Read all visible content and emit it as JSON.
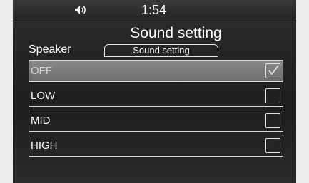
{
  "status_bar": {
    "clock": "1:54",
    "volume_icon": "speaker-volume-icon"
  },
  "header": {
    "title": "Sound setting",
    "section_label": "Speaker",
    "tab_label": "Sound setting"
  },
  "options": [
    {
      "label": "OFF",
      "checked": true
    },
    {
      "label": "LOW",
      "checked": false
    },
    {
      "label": "MID",
      "checked": false
    },
    {
      "label": "HIGH",
      "checked": false
    }
  ],
  "colors": {
    "screen_background": "#242424",
    "selected_row": "#7a7a7a",
    "text": "#ffffff",
    "page_background": "#ececec"
  }
}
